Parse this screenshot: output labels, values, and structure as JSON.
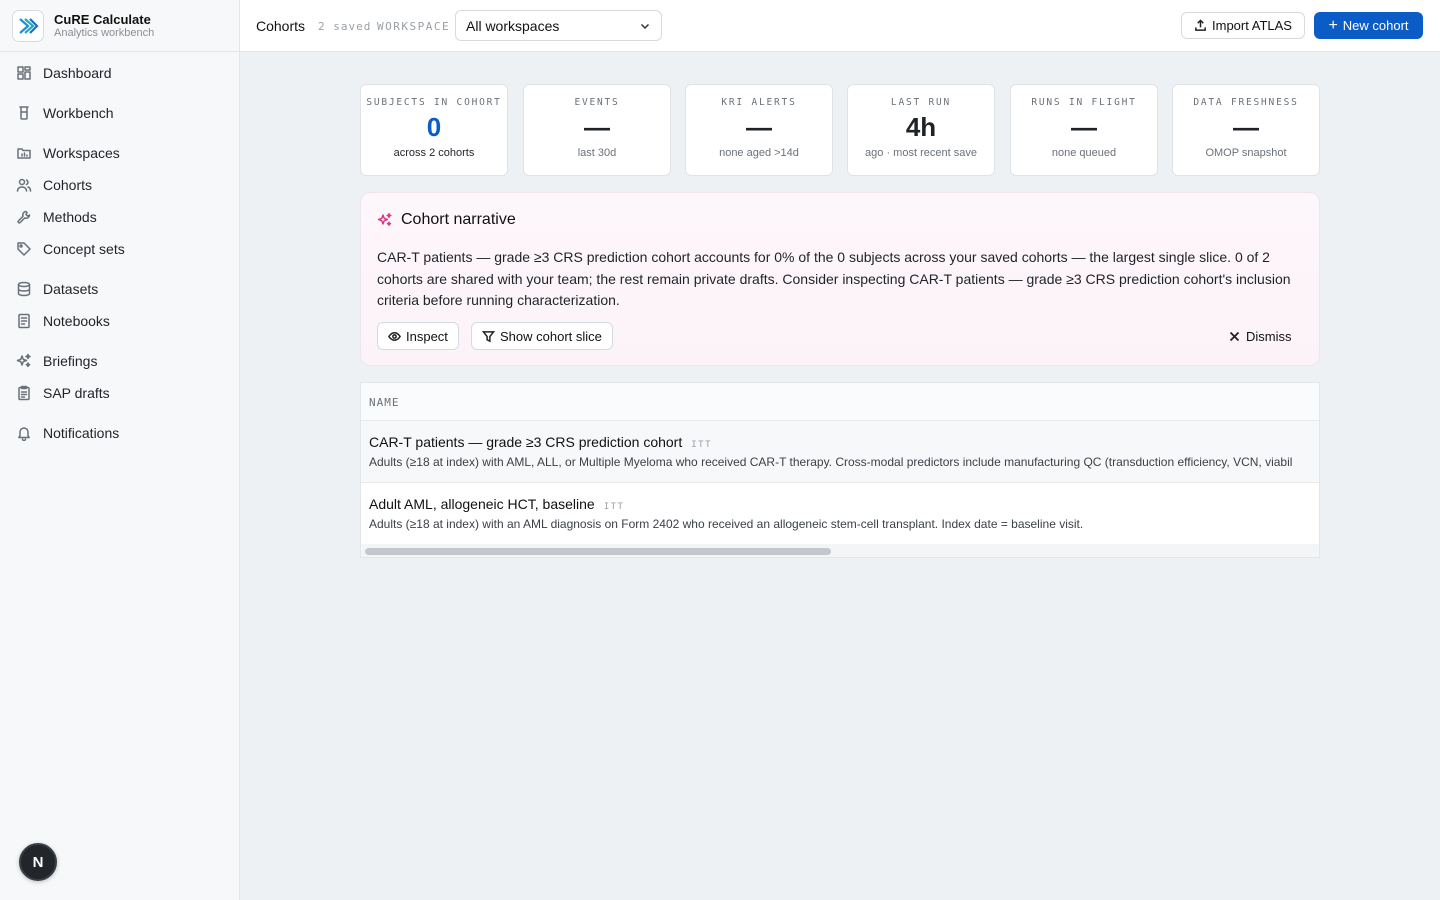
{
  "brand": {
    "title": "CuRE Calculate",
    "subtitle": "Analytics workbench"
  },
  "sidebar": {
    "items": [
      {
        "label": "Dashboard",
        "icon": "grid-icon"
      },
      {
        "label": "Workbench",
        "icon": "flask-icon"
      },
      {
        "label": "Workspaces",
        "icon": "folder-chart-icon"
      },
      {
        "label": "Cohorts",
        "icon": "users-icon"
      },
      {
        "label": "Methods",
        "icon": "wrench-icon"
      },
      {
        "label": "Concept sets",
        "icon": "tag-icon"
      },
      {
        "label": "Datasets",
        "icon": "database-icon"
      },
      {
        "label": "Notebooks",
        "icon": "notebook-icon"
      },
      {
        "label": "Briefings",
        "icon": "sparkles-icon"
      },
      {
        "label": "SAP drafts",
        "icon": "clipboard-icon"
      },
      {
        "label": "Notifications",
        "icon": "bell-icon"
      }
    ],
    "avatar_initial": "N"
  },
  "header": {
    "title": "Cohorts",
    "saved": "2 saved",
    "workspace_label": "WORKSPACE",
    "workspace_value": "All workspaces",
    "import_label": "Import ATLAS",
    "new_label": "New cohort"
  },
  "kpis": [
    {
      "label": "Subjects in cohort",
      "value": "0",
      "sub": "across 2 cohorts"
    },
    {
      "label": "Events",
      "value": "—",
      "sub": "last 30d"
    },
    {
      "label": "KRI alerts",
      "value": "—",
      "sub": "none aged >14d"
    },
    {
      "label": "Last run",
      "value": "4h",
      "sub": "ago · most recent save"
    },
    {
      "label": "Runs in flight",
      "value": "—",
      "sub": "none queued"
    },
    {
      "label": "Data freshness",
      "value": "—",
      "sub": "OMOP snapshot"
    }
  ],
  "narrative": {
    "title": "Cohort narrative",
    "text": "CAR-T patients — grade ≥3 CRS prediction cohort accounts for 0% of the 0 subjects across your saved cohorts — the largest single slice. 0 of 2 cohorts are shared with your team; the rest remain private drafts. Consider inspecting CAR-T patients — grade ≥3 CRS prediction cohort's inclusion criteria before running characterization.",
    "inspect_label": "Inspect",
    "slice_label": "Show cohort slice",
    "dismiss_label": "Dismiss"
  },
  "table": {
    "header": "NAME",
    "rows": [
      {
        "name": "CAR-T patients — grade ≥3 CRS prediction cohort",
        "tag": "ITT",
        "desc": "Adults (≥18 at index) with AML, ALL, or Multiple Myeloma who received CAR-T therapy. Cross-modal predictors include manufacturing QC (transduction efficiency, VCN, viabil"
      },
      {
        "name": "Adult AML, allogeneic HCT, baseline",
        "tag": "ITT",
        "desc": "Adults (≥18 at index) with an AML diagnosis on Form 2402 who received an allogeneic stem-cell transplant. Index date = baseline visit."
      }
    ]
  },
  "colors": {
    "accent": "#0b5cc6",
    "narrative_icon": "#d6337f"
  }
}
